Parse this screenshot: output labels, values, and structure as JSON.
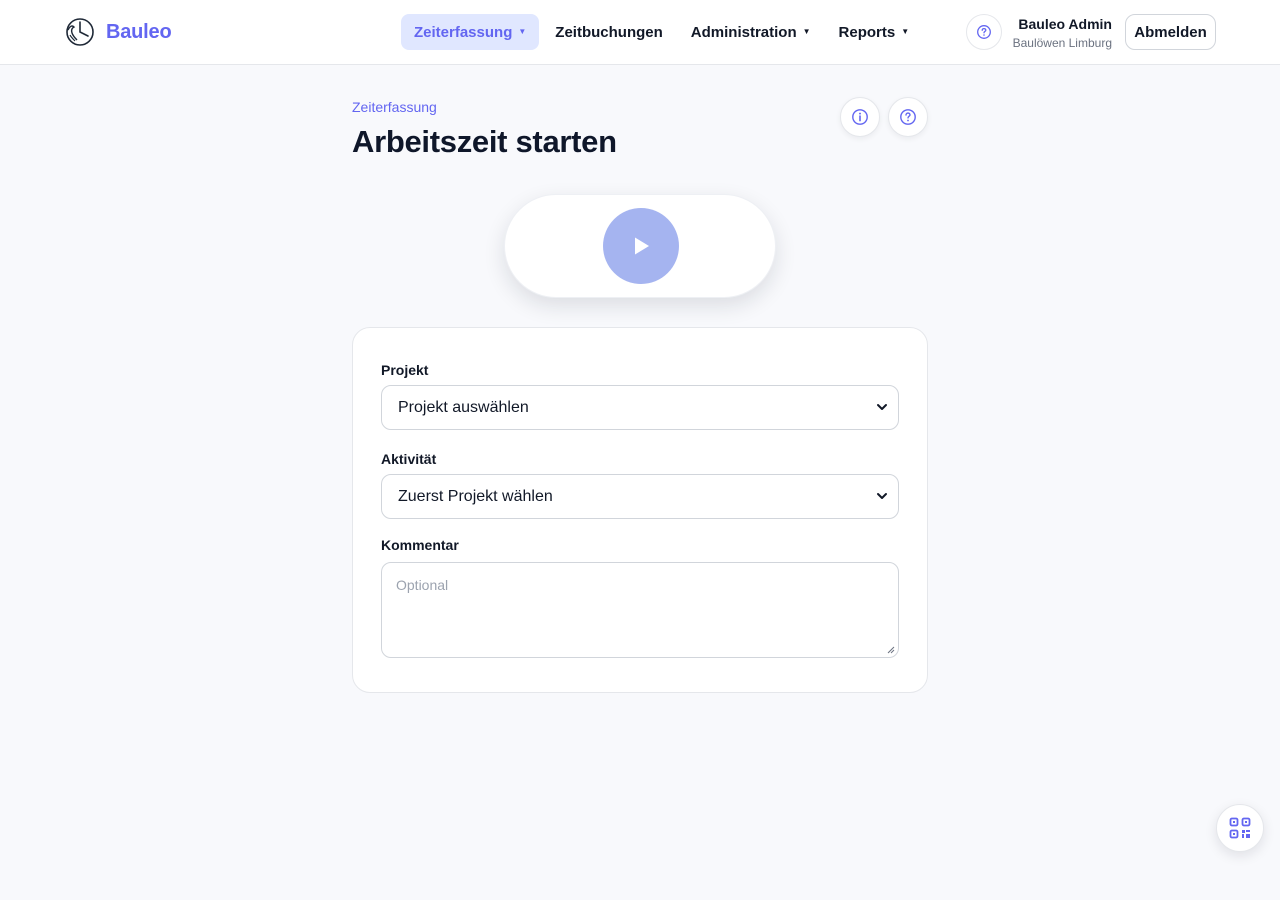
{
  "app": {
    "name": "Bauleo"
  },
  "nav": {
    "items": [
      {
        "label": "Zeiterfassung",
        "dropdown": true,
        "active": true
      },
      {
        "label": "Zeitbuchungen",
        "dropdown": false,
        "active": false
      },
      {
        "label": "Administration",
        "dropdown": true,
        "active": false
      },
      {
        "label": "Reports",
        "dropdown": true,
        "active": false
      }
    ]
  },
  "header": {
    "help_icon": "question-circle-icon",
    "user_name": "Bauleo Admin",
    "user_org": "Baulöwen Limburg",
    "logout_label": "Abmelden"
  },
  "page": {
    "eyebrow": "Zeiterfassung",
    "title": "Arbeitszeit starten",
    "info_icon": "info-circle-icon",
    "help_icon": "question-circle-icon"
  },
  "start": {
    "icon": "play-icon"
  },
  "form": {
    "project_label": "Projekt",
    "project_value": "Projekt auswählen",
    "activity_label": "Aktivität",
    "activity_value": "Zuerst Projekt wählen",
    "comment_label": "Kommentar",
    "comment_placeholder": "Optional"
  },
  "floating": {
    "icon": "qr-code-icon"
  },
  "colors": {
    "accent": "#6366f1",
    "accent_light": "#e0e7ff",
    "start_button": "#a5b4f0",
    "background": "#f8f9fc"
  }
}
